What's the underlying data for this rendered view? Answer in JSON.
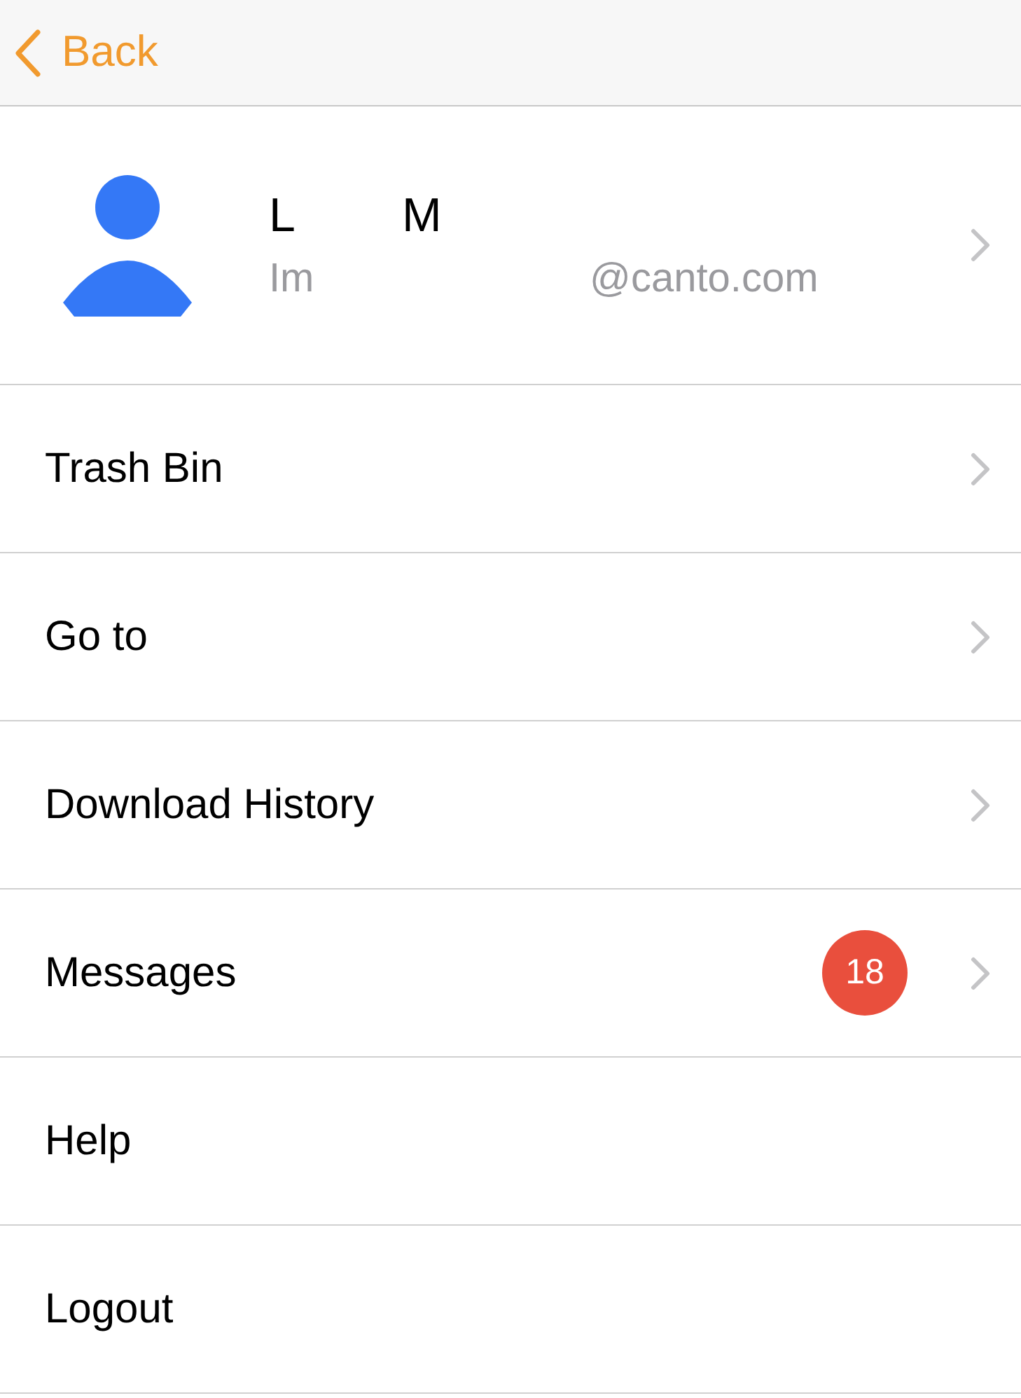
{
  "header": {
    "back_label": "Back"
  },
  "profile": {
    "name_parts": [
      "L",
      "M"
    ],
    "email_parts": [
      "Im",
      "@canto.com"
    ],
    "chevron": true
  },
  "menu": [
    {
      "label": "Trash Bin",
      "chevron": true
    },
    {
      "label": "Go to",
      "chevron": true
    },
    {
      "label": "Download History",
      "chevron": true
    },
    {
      "label": "Messages",
      "badge": "18",
      "chevron": true
    },
    {
      "label": "Help",
      "chevron": false
    },
    {
      "label": "Logout",
      "chevron": false
    }
  ]
}
